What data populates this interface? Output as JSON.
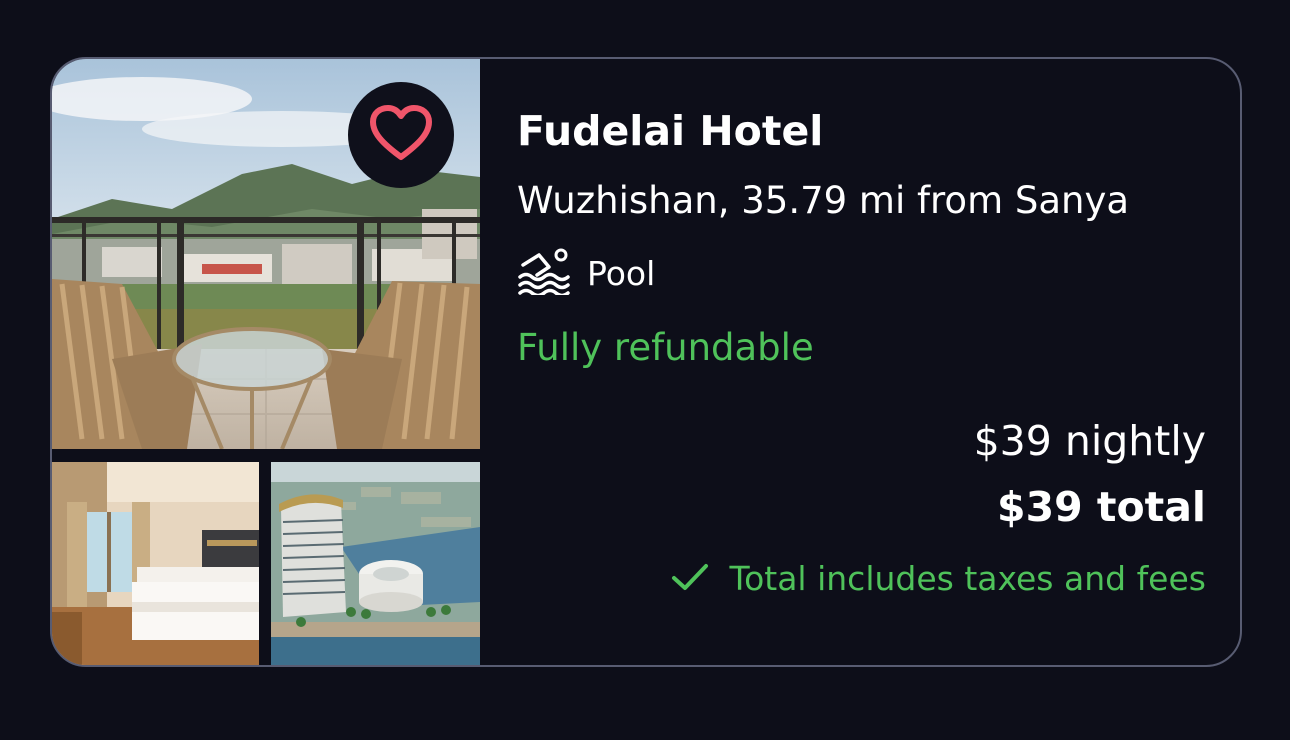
{
  "hotel": {
    "name": "Fudelai Hotel",
    "location": "Wuzhishan, 35.79 mi from Sanya",
    "amenity": {
      "icon": "swimming-pool-icon",
      "label": "Pool"
    },
    "refund_label": "Fully refundable",
    "price_nightly": "$39 nightly",
    "price_total": "$39 total",
    "taxes_note": {
      "icon": "checkmark-icon",
      "label": "Total includes taxes and fees"
    },
    "favorite": {
      "icon": "heart-icon",
      "saved": false
    }
  },
  "colors": {
    "background": "#0d0e19",
    "border": "#585c72",
    "accent_green": "#4fc25a",
    "heart": "#f0556a",
    "text": "#ffffff"
  },
  "photos": [
    "balcony-view-photo",
    "bedroom-photo",
    "exterior-photo"
  ]
}
